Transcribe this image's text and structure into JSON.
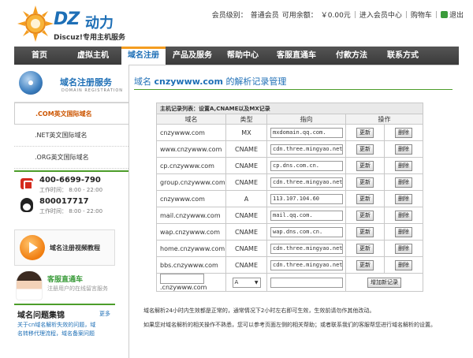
{
  "header": {
    "logo_main": "DZ",
    "logo_cn": "动力",
    "logo_sub": "Discuz!专用主机服务",
    "member_level_label": "会员级别：",
    "member_level": "普通会员",
    "balance_label": "可用余额：",
    "balance": "￥0.00元",
    "enter_member": "进入会员中心",
    "cart": "购物车",
    "logout": "退出"
  },
  "nav": {
    "items": [
      "首页",
      "虚拟主机",
      "域名注册",
      "产品及服务",
      "帮助中心",
      "客服直通车",
      "付款方法",
      "联系方式"
    ],
    "active_index": 2
  },
  "sidebar": {
    "title": "域名注册服务",
    "title_en": "DOMAIN REGISTRATION",
    "menu": [
      ".COM英文国际域名",
      ".NET英文国际域名",
      ".ORG英文国际域名"
    ],
    "active_index": 0,
    "contacts": [
      {
        "icon": "phone-icon",
        "number": "400-6699-790",
        "time": "工作时间： 8:00 - 22:00"
      },
      {
        "icon": "qq-icon",
        "number": "800017717",
        "time": "工作时间： 8:00 - 22:00"
      }
    ],
    "video_label": "域名注册视频教程",
    "service_title": "客服直通车",
    "service_sub": "注册用户的在线留言服务",
    "faq_title": "域名问题集锦",
    "faq_more": "更多",
    "faq_items": [
      "关于cn域名解析失效的问题，域",
      "名转移代理流程，域名备案问题"
    ]
  },
  "main": {
    "title_prefix": "域名",
    "domain": "cnzywww.com",
    "title_suffix": "的解析记录管理",
    "table_caption": "主机记录列表：设置A,CNAME以及MX记录",
    "columns": [
      "域名",
      "类型",
      "指向",
      "操作"
    ],
    "rows": [
      {
        "host": "cnzywww.com",
        "type": "MX",
        "value": "mxdomain.qq.com."
      },
      {
        "host": "www.cnzywww.com",
        "type": "CNAME",
        "value": "cdn.three.mingyao.net"
      },
      {
        "host": "cp.cnzywww.com",
        "type": "CNAME",
        "value": "cp.dns.com.cn."
      },
      {
        "host": "group.cnzywww.com",
        "type": "CNAME",
        "value": "cdn.three.mingyao.net"
      },
      {
        "host": "cnzywww.com",
        "type": "A",
        "value": "113.107.104.60"
      },
      {
        "host": "mail.cnzywww.com",
        "type": "CNAME",
        "value": "mail.qq.com."
      },
      {
        "host": "wap.cnzywww.com",
        "type": "CNAME",
        "value": "wap.dns.com.cn."
      },
      {
        "host": "home.cnzywww.com",
        "type": "CNAME",
        "value": "cdn.three.mingyao.net"
      },
      {
        "host": "bbs.cnzywww.com",
        "type": "CNAME",
        "value": "cdn.three.mingyao.net"
      }
    ],
    "update_label": "更新",
    "delete_label": "删除",
    "new_row": {
      "suffix": ".cnzywww.com",
      "type": "A",
      "add_label": "增加新记录"
    },
    "note_1": "域名解析24小时内生效都是正常的，通常情况下2小时左右即可生效，生效前请勿作其他改动。",
    "note_2": "如果您对域名解析的相关操作不熟悉，您可以参考页面左侧的相关帮助；或者联系我们的客服帮您进行域名解析的设置。"
  }
}
